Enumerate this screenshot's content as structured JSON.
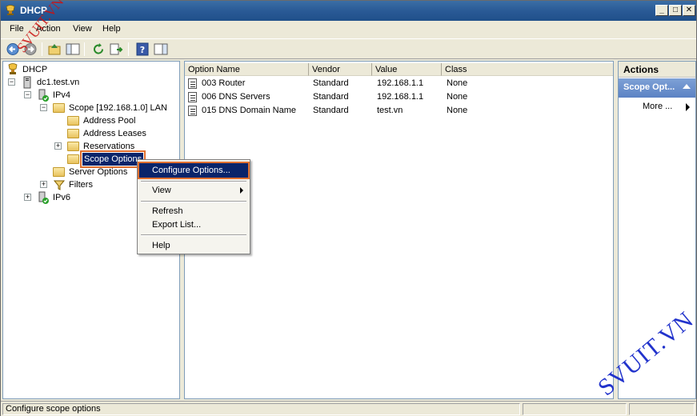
{
  "window": {
    "title": "DHCP"
  },
  "menu": [
    "File",
    "Action",
    "View",
    "Help"
  ],
  "tree": {
    "root": "DHCP",
    "server": "dc1.test.vn",
    "ipv4": "IPv4",
    "scope": "Scope [192.168.1.0] LAN",
    "address_pool": "Address Pool",
    "address_leases": "Address Leases",
    "reservations": "Reservations",
    "scope_options": "Scope Options",
    "server_options": "Server Options",
    "filters": "Filters",
    "ipv6": "IPv6"
  },
  "list": {
    "columns": [
      "Option Name",
      "Vendor",
      "Value",
      "Class"
    ],
    "rows": [
      {
        "name": "003 Router",
        "vendor": "Standard",
        "value": "192.168.1.1",
        "class": "None"
      },
      {
        "name": "006 DNS Servers",
        "vendor": "Standard",
        "value": "192.168.1.1",
        "class": "None"
      },
      {
        "name": "015 DNS Domain Name",
        "vendor": "Standard",
        "value": "test.vn",
        "class": "None"
      }
    ]
  },
  "actions": {
    "title": "Actions",
    "section": "Scope Opt...",
    "more": "More ..."
  },
  "context_menu": {
    "configure": "Configure Options...",
    "view": "View",
    "refresh": "Refresh",
    "export": "Export List...",
    "help": "Help"
  },
  "status": {
    "text": "Configure scope options"
  },
  "watermarks": {
    "top_left": "SVUIT.VN",
    "bottom_right": "SVUIT.VN"
  },
  "colors": {
    "title_bar": "#2a5a96",
    "selection": "#0a246a",
    "highlight_outline": "#e07030",
    "watermark_red": "#cc1111",
    "watermark_blue": "#2233cc"
  }
}
